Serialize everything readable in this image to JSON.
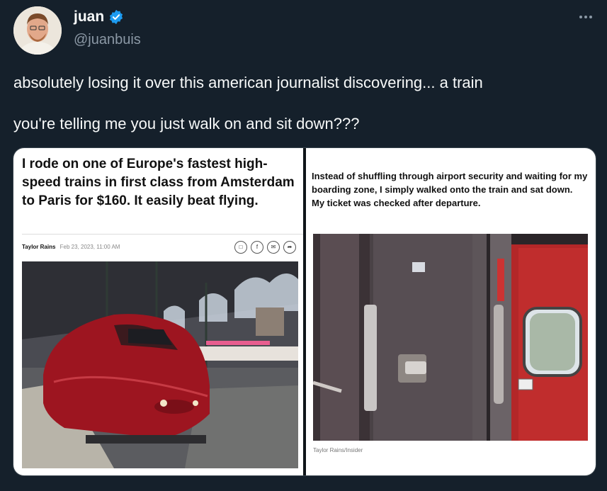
{
  "author": {
    "name": "juan",
    "handle": "@juanbuis",
    "verified_color": "#1d9bf0"
  },
  "menu_icon": "more-horizontal-icon",
  "tweet": {
    "line1": "absolutely losing it over this american journalist discovering... a train",
    "line2": "you're telling me you just walk on and sit down???"
  },
  "media": {
    "left": {
      "headline": "I rode on one of Europe's fastest high-speed trains in first class from Amsterdam to Paris for $160. It easily beat flying.",
      "author": "Taylor Rains",
      "date": "Feb 23, 2023, 11:00 AM",
      "share_icons": [
        "bookmark-icon",
        "facebook-icon",
        "email-icon",
        "share-icon"
      ]
    },
    "right": {
      "caption": "Instead of shuffling through airport security and waiting for my boarding zone, I simply walked onto the train and sat down. My ticket was checked after departure.",
      "credit": "Taylor Rains/Insider"
    }
  }
}
